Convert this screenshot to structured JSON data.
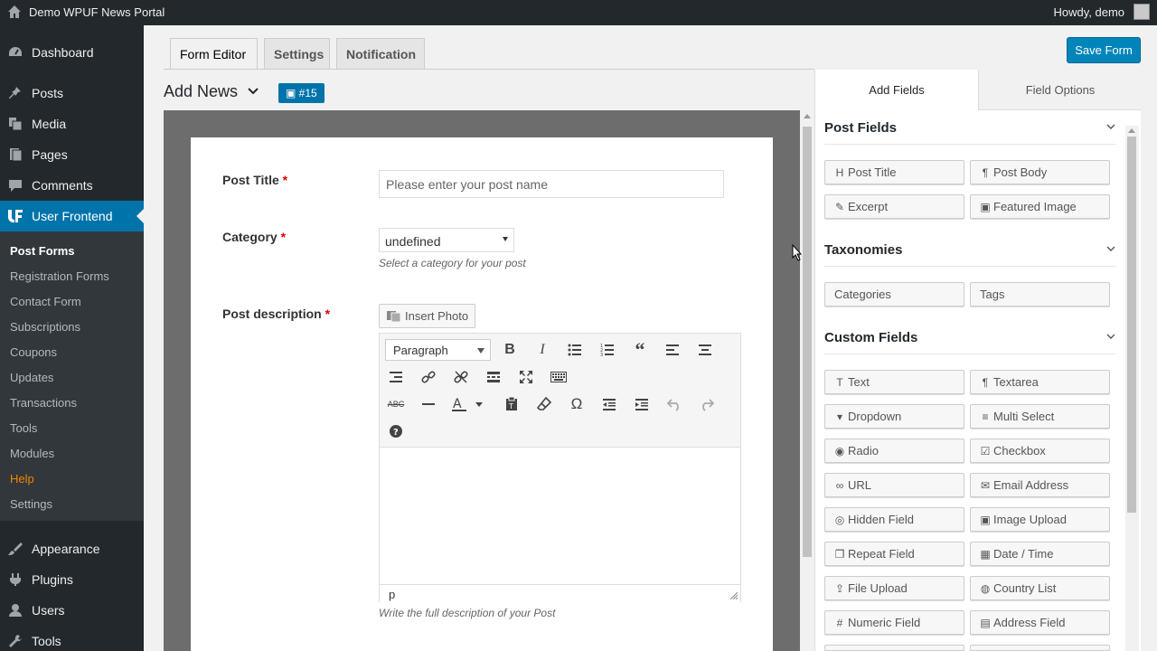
{
  "adminbar": {
    "site_name": "Demo WPUF News Portal",
    "howdy": "Howdy, demo"
  },
  "sidebar": {
    "items": [
      {
        "label": "Dashboard",
        "icon": "dashboard-icon"
      },
      {
        "label": "Posts",
        "icon": "pin-icon"
      },
      {
        "label": "Media",
        "icon": "media-icon"
      },
      {
        "label": "Pages",
        "icon": "page-icon"
      },
      {
        "label": "Comments",
        "icon": "comment-icon"
      },
      {
        "label": "User Frontend",
        "icon": "wpuf-icon"
      },
      {
        "label": "Appearance",
        "icon": "brush-icon"
      },
      {
        "label": "Plugins",
        "icon": "plugin-icon"
      },
      {
        "label": "Users",
        "icon": "users-icon"
      },
      {
        "label": "Tools",
        "icon": "tools-icon"
      }
    ],
    "submenu": [
      "Post Forms",
      "Registration Forms",
      "Contact Form",
      "Subscriptions",
      "Coupons",
      "Updates",
      "Transactions",
      "Tools",
      "Modules",
      "Help",
      "Settings"
    ]
  },
  "tabs": {
    "form_editor": "Form Editor",
    "settings": "Settings",
    "notification": "Notification"
  },
  "save_button": "Save Form",
  "form": {
    "title": "Add News",
    "shortcode": "#15"
  },
  "fields": {
    "post_title": {
      "label": "Post Title",
      "required": "*",
      "placeholder": "Please enter your post name"
    },
    "category": {
      "label": "Category",
      "required": "*",
      "value": "undefined",
      "help": "Select a category for your post"
    },
    "description": {
      "label": "Post description",
      "required": "*",
      "insert_photo": "Insert Photo",
      "format": "Paragraph",
      "status_path": "p",
      "help": "Write the full description of your Post"
    }
  },
  "right_panel": {
    "tabs": {
      "add_fields": "Add Fields",
      "field_options": "Field Options"
    },
    "sections": {
      "post_fields": {
        "title": "Post Fields",
        "buttons": [
          {
            "label": "Post Title",
            "icon": "H"
          },
          {
            "label": "Post Body",
            "icon": "¶"
          },
          {
            "label": "Excerpt",
            "icon": "✎"
          },
          {
            "label": "Featured Image",
            "icon": "▣"
          }
        ]
      },
      "taxonomies": {
        "title": "Taxonomies",
        "buttons": [
          {
            "label": "Categories",
            "icon": ""
          },
          {
            "label": "Tags",
            "icon": ""
          }
        ]
      },
      "custom_fields": {
        "title": "Custom Fields",
        "buttons": [
          {
            "label": "Text",
            "icon": "T"
          },
          {
            "label": "Textarea",
            "icon": "¶"
          },
          {
            "label": "Dropdown",
            "icon": "▾"
          },
          {
            "label": "Multi Select",
            "icon": "≡"
          },
          {
            "label": "Radio",
            "icon": "◉"
          },
          {
            "label": "Checkbox",
            "icon": "☑"
          },
          {
            "label": "URL",
            "icon": "∞"
          },
          {
            "label": "Email Address",
            "icon": "✉"
          },
          {
            "label": "Hidden Field",
            "icon": "◎"
          },
          {
            "label": "Image Upload",
            "icon": "▣"
          },
          {
            "label": "Repeat Field",
            "icon": "❐"
          },
          {
            "label": "Date / Time",
            "icon": "▦"
          },
          {
            "label": "File Upload",
            "icon": "⇪"
          },
          {
            "label": "Country List",
            "icon": "◍"
          },
          {
            "label": "Numeric Field",
            "icon": "#"
          },
          {
            "label": "Address Field",
            "icon": "▤"
          }
        ]
      }
    }
  }
}
